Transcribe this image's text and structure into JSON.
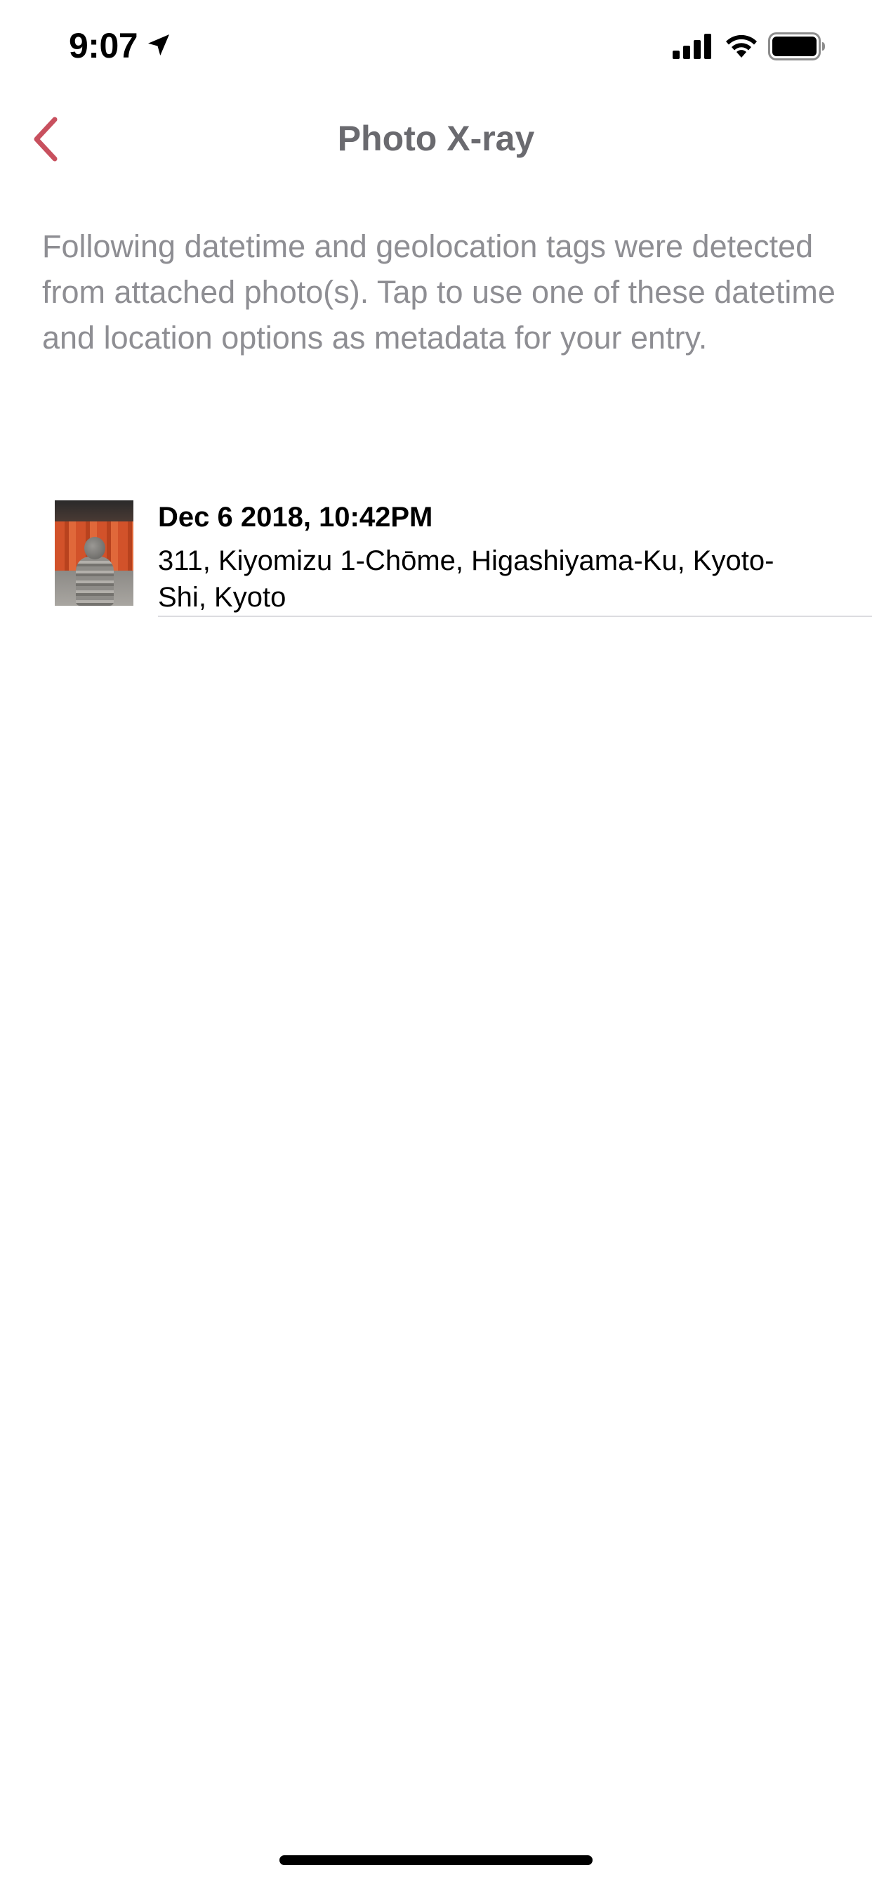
{
  "status_bar": {
    "time": "9:07",
    "icons": [
      "location-arrow-icon",
      "cellular-signal-icon",
      "wifi-icon",
      "battery-icon"
    ]
  },
  "nav": {
    "title": "Photo X-ray",
    "back_icon": "chevron-left-icon",
    "accent_color": "#c8505e"
  },
  "description": "Following datetime and geolocation tags were detected from attached photo(s). Tap to use one of these datetime and location options as metadata for your entry.",
  "options": [
    {
      "datetime": "Dec 6 2018, 10:42PM",
      "address": "311, Kiyomizu 1-Chōme, Higashiyama-Ku, Kyoto-Shi, Kyoto",
      "thumbnail": "photo-thumbnail"
    }
  ]
}
